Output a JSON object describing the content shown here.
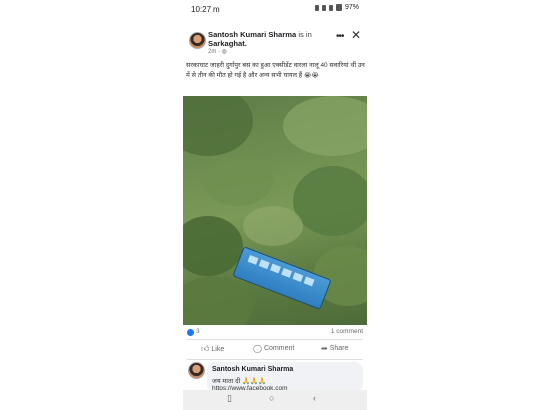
{
  "status_bar": {
    "time": "10:27",
    "indicator": "m",
    "battery": "97%"
  },
  "post": {
    "author": "Santosh Kumari Sharma",
    "author_suffix": "is in",
    "place": "Sarkaghat.",
    "meta": "2m · ",
    "text": "सरकाघाट जाहरी दुर्गापुर बस का हुआ एक्सीडेंट वारला नालू 40 सवारियां थीं उन में से तीन की मौत हो गई है और अन्य सभी घायल हैं 😭😭"
  },
  "reactions": {
    "like_count": "3",
    "comment_count": "1 comment"
  },
  "actions": {
    "like": "Like",
    "comment": "Comment",
    "share": "Share"
  },
  "comment": {
    "author": "Santosh Kumari Sharma",
    "text": "जय माता दी 🙏🙏🙏",
    "link": "https://www.facebook.com"
  },
  "colors": {
    "accent": "#1877f2",
    "bus": "#3a8bd0"
  },
  "icons": {
    "more": "more-icon",
    "close": "close-icon",
    "like": "thumbs-up-icon",
    "comment": "comment-icon",
    "share": "share-icon"
  }
}
